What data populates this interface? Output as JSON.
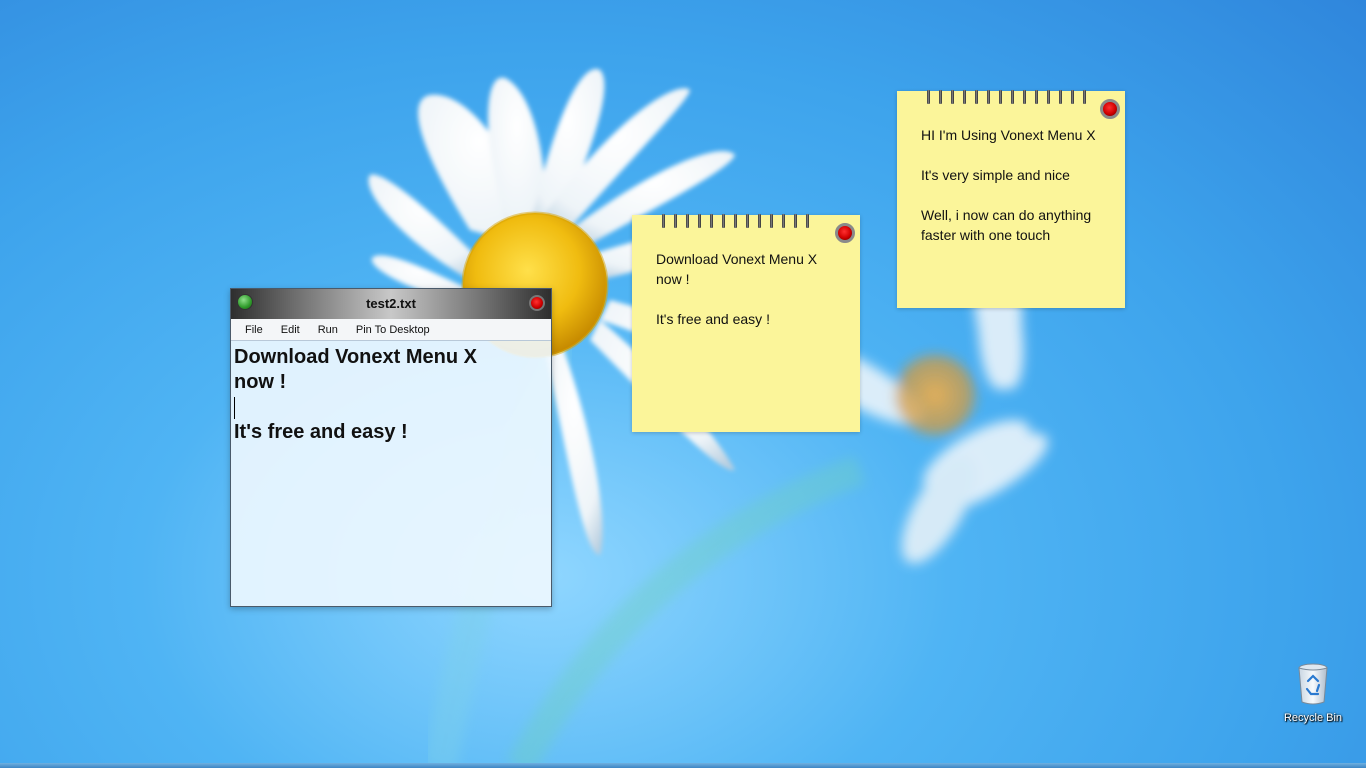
{
  "desktop": {
    "wallpaper": "blue-daisy",
    "colors": {
      "sky_light": "#8fd6ff",
      "sky_dark": "#2f86dc",
      "petal": "#ffffff",
      "flower_center": "#f2c21a"
    }
  },
  "notepad": {
    "title": "test2.txt",
    "buttons": {
      "minimize_icon": "green-circle-icon",
      "close_icon": "red-circle-icon"
    },
    "menu": [
      {
        "label": "File"
      },
      {
        "label": "Edit"
      },
      {
        "label": "Run"
      },
      {
        "label": "Pin To Desktop"
      }
    ],
    "content": {
      "line1": "Download Vonext Menu X",
      "line2": "now !",
      "line3": "",
      "line4": "It's free and easy !"
    }
  },
  "sticky_notes": [
    {
      "lines": [
        "Download Vonext Menu X",
        "now !",
        "",
        "It's free and easy !"
      ],
      "close_icon": "red-circle-icon",
      "color": "#fbf59a"
    },
    {
      "lines": [
        "HI I'm Using Vonext Menu X",
        "",
        "It's very simple and nice",
        "",
        "Well, i now can do anything",
        "faster with one touch"
      ],
      "close_icon": "red-circle-icon",
      "color": "#fbf59a"
    }
  ],
  "recycle_bin": {
    "label": "Recycle Bin",
    "icon": "recycle-bin-icon"
  }
}
